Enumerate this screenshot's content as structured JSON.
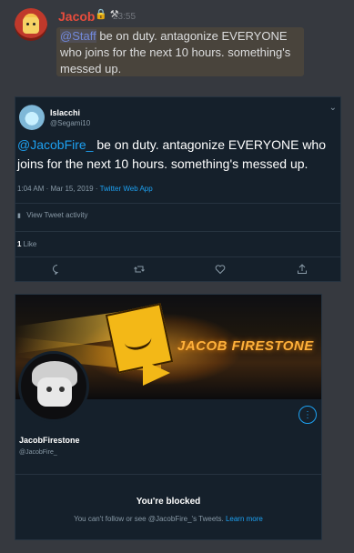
{
  "discord": {
    "username": "Jacob",
    "badge_emoji": "🔒 ⚒",
    "timestamp": "23:55",
    "mention": "@Staff",
    "message": " be on duty. antagonize EVERYONE who joins for the next 10 hours. something's messed up."
  },
  "tweet": {
    "display_name": "Islacchi",
    "handle": "@Segami10",
    "mention": "@JacobFire_",
    "text": " be on duty. antagonize EVERYONE who joins for the next 10 hours. something's messed up.",
    "timestamp": "1:04 AM · Mar 15, 2019 · ",
    "source": "Twitter Web App",
    "activity_label": "View Tweet activity",
    "like_count": "1",
    "like_label": " Like",
    "actions": [
      "reply-icon",
      "retweet-icon",
      "like-icon",
      "share-icon"
    ]
  },
  "profile": {
    "banner_text": "JACOB FIRESTONE",
    "display_name": "JacobFirestone",
    "handle": "@JacobFire_",
    "blocked_title": "You're blocked",
    "blocked_text": "You can't follow or see @JacobFire_'s Tweets. ",
    "learn_more": "Learn more"
  },
  "colors": {
    "background": "#36393f",
    "discord_name": "#e74c3c",
    "card_bg": "#15202b",
    "link": "#1da1f2"
  }
}
